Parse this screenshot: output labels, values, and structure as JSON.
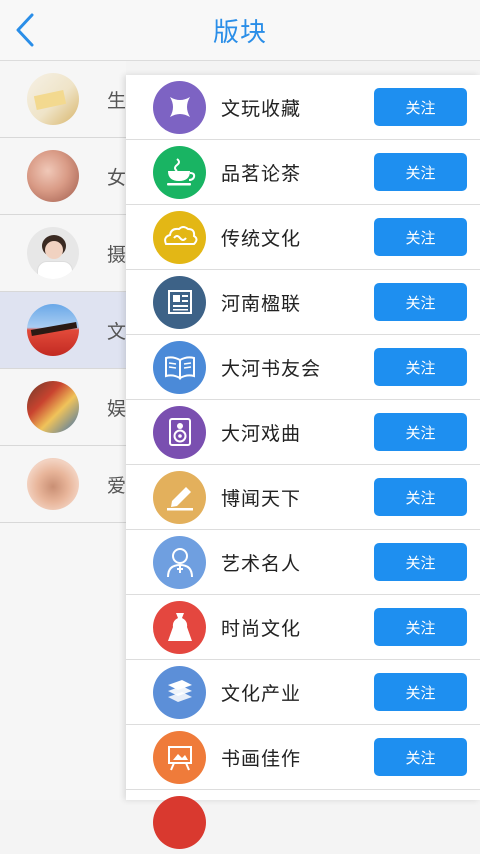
{
  "header": {
    "title": "版块",
    "back_icon": "chevron-left-icon"
  },
  "colors": {
    "accent": "#1e8ff0",
    "active_bg": "#dfe3f1"
  },
  "left_menu": [
    {
      "label": "生",
      "active": false
    },
    {
      "label": "女",
      "active": false
    },
    {
      "label": "摄",
      "active": false
    },
    {
      "label": "文",
      "active": true
    },
    {
      "label": "娱",
      "active": false
    },
    {
      "label": "爱",
      "active": false
    }
  ],
  "boards": [
    {
      "name": "文玩收藏",
      "icon": "antique-icon",
      "color": "#7d63c3",
      "button": "关注"
    },
    {
      "name": "品茗论茶",
      "icon": "tea-cup-icon",
      "color": "#19b463",
      "button": "关注"
    },
    {
      "name": "传统文化",
      "icon": "auspicious-cloud-icon",
      "color": "#e3b715",
      "button": "关注"
    },
    {
      "name": "河南楹联",
      "icon": "newspaper-icon",
      "color": "#3d6287",
      "button": "关注"
    },
    {
      "name": "大河书友会",
      "icon": "open-book-icon",
      "color": "#4b8ad8",
      "button": "关注"
    },
    {
      "name": "大河戏曲",
      "icon": "speaker-icon",
      "color": "#7a4fb0",
      "button": "关注"
    },
    {
      "name": "博闻天下",
      "icon": "pen-icon",
      "color": "#e3b05c",
      "button": "关注"
    },
    {
      "name": "艺术名人",
      "icon": "person-icon",
      "color": "#6f9fe0",
      "button": "关注"
    },
    {
      "name": "时尚文化",
      "icon": "dress-icon",
      "color": "#e4473f",
      "button": "关注"
    },
    {
      "name": "文化产业",
      "icon": "stacked-books-icon",
      "color": "#5c8fd8",
      "button": "关注"
    },
    {
      "name": "书画佳作",
      "icon": "easel-icon",
      "color": "#ef7b3a",
      "button": "关注"
    }
  ]
}
